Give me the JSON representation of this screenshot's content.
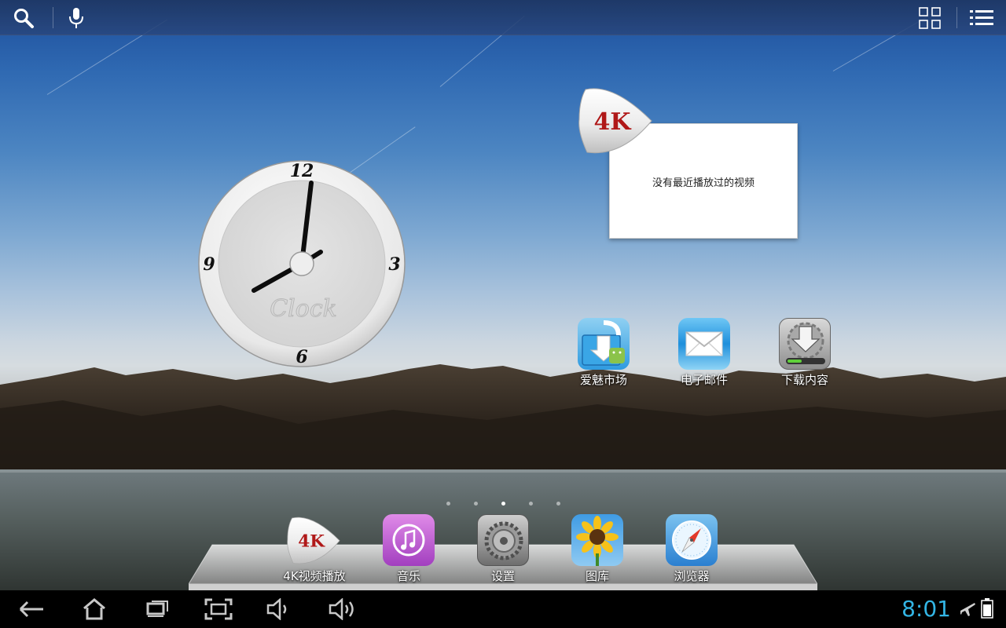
{
  "top_bar": {
    "icons": [
      "search-icon",
      "mic-icon",
      "apps-grid-icon",
      "menu-list-icon"
    ]
  },
  "clock_widget": {
    "numerals": [
      "12",
      "3",
      "6",
      "9"
    ],
    "brand_text": "Clock",
    "time": "8:01"
  },
  "video_widget": {
    "logo_text": "4K",
    "message": "没有最近播放过的视频"
  },
  "desktop_apps": [
    {
      "label": "爱魅市场",
      "icon": "app-market-icon"
    },
    {
      "label": "电子邮件",
      "icon": "email-icon"
    },
    {
      "label": "下载内容",
      "icon": "downloads-icon"
    }
  ],
  "page_indicator": {
    "count": 5,
    "active": 3
  },
  "dock": [
    {
      "label": "4K视频播放",
      "icon": "4k-player-icon",
      "logo_text": "4K"
    },
    {
      "label": "音乐",
      "icon": "music-icon"
    },
    {
      "label": "设置",
      "icon": "settings-gear-icon"
    },
    {
      "label": "图库",
      "icon": "gallery-sunflower-icon"
    },
    {
      "label": "浏览器",
      "icon": "browser-compass-icon"
    }
  ],
  "nav_bar": {
    "buttons": [
      "back-icon",
      "home-icon",
      "recent-apps-icon",
      "screenshot-icon",
      "volume-down-icon",
      "volume-up-icon"
    ],
    "time": "8:01",
    "status_icons": [
      "airplane-mode-icon",
      "battery-icon"
    ]
  },
  "colors": {
    "clock_text": "#33b5e5",
    "brand_red": "#b01818"
  }
}
